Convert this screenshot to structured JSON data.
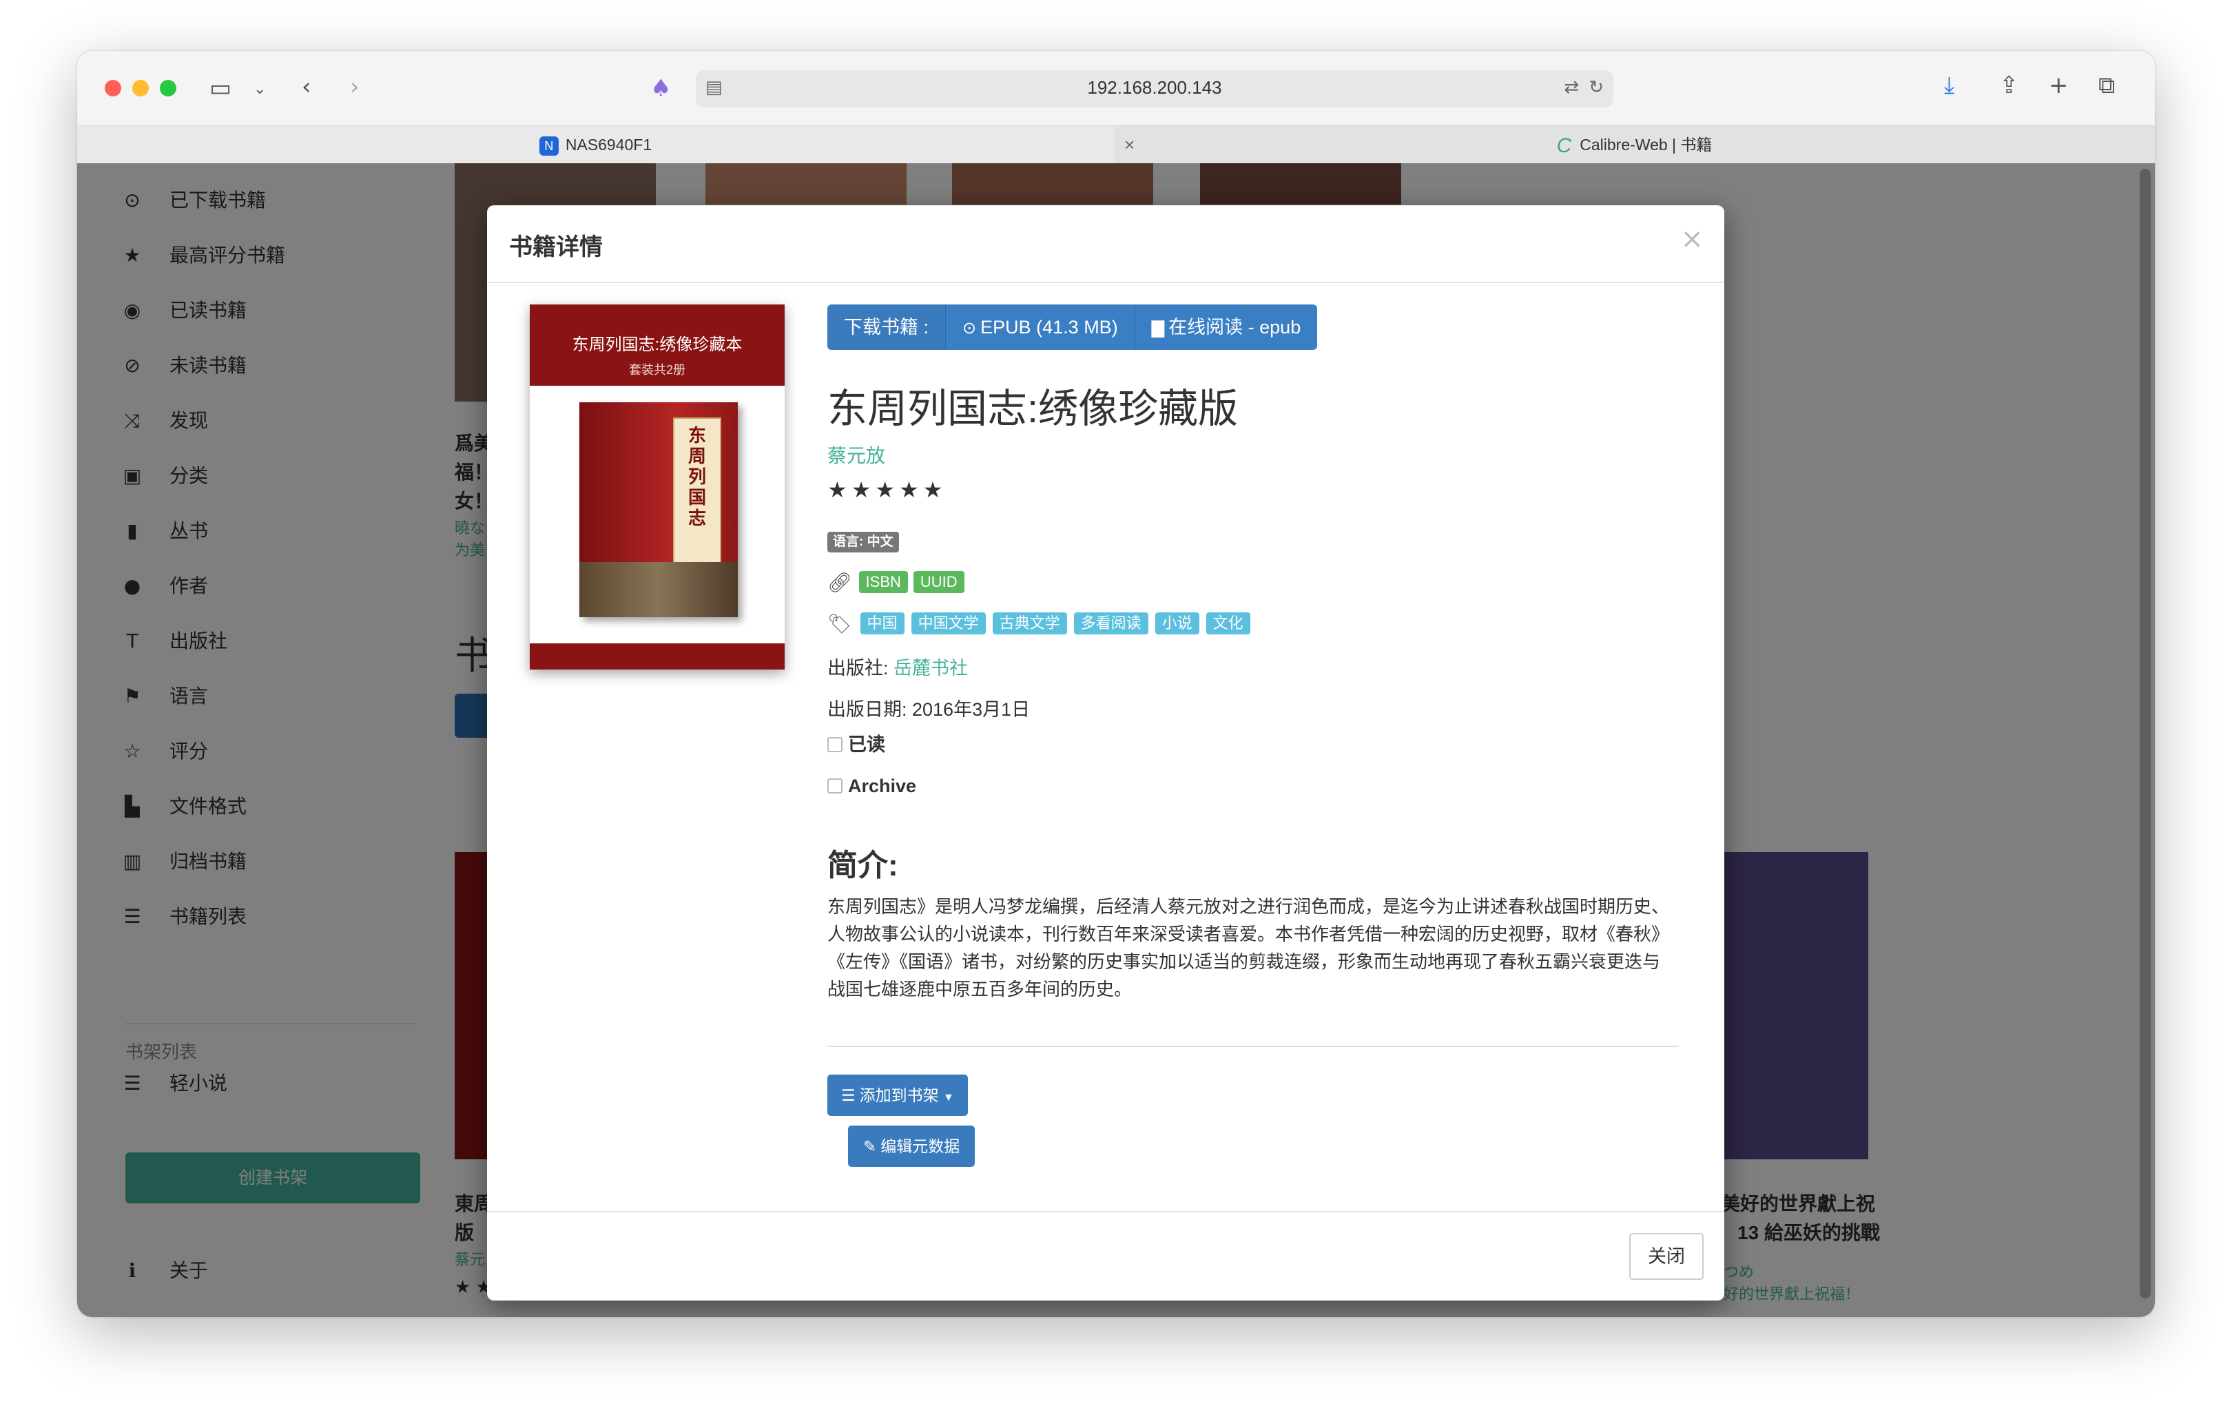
{
  "browser": {
    "url": "192.168.200.143",
    "tabs": [
      {
        "label": "NAS6940F1",
        "favicon": "N"
      },
      {
        "label": "Calibre-Web | 书籍",
        "favicon": "C"
      }
    ],
    "icons": [
      "sidebar-toggle-icon",
      "chevron-down-icon",
      "back-icon",
      "forward-icon",
      "extension-icon",
      "site-settings-icon",
      "translate-icon",
      "reload-icon",
      "downloads-icon",
      "share-icon",
      "new-tab-icon",
      "tab-overview-icon"
    ]
  },
  "sidebar": {
    "items": [
      {
        "label": "已下载书籍",
        "icon": "download-icon"
      },
      {
        "label": "最高评分书籍",
        "icon": "star-icon"
      },
      {
        "label": "已读书籍",
        "icon": "eye-icon"
      },
      {
        "label": "未读书籍",
        "icon": "eye-slash-icon"
      },
      {
        "label": "发现",
        "icon": "random-icon"
      },
      {
        "label": "分类",
        "icon": "inbox-icon"
      },
      {
        "label": "丛书",
        "icon": "bookmark-icon"
      },
      {
        "label": "作者",
        "icon": "user-icon"
      },
      {
        "label": "出版社",
        "icon": "text-size-icon"
      },
      {
        "label": "语言",
        "icon": "flag-icon"
      },
      {
        "label": "评分",
        "icon": "star-empty-icon"
      },
      {
        "label": "文件格式",
        "icon": "file-icon"
      },
      {
        "label": "归档书籍",
        "icon": "trash-icon"
      },
      {
        "label": "书籍列表",
        "icon": "list-icon"
      }
    ],
    "shelves_header": "书架列表",
    "shelves": [
      {
        "label": "轻小说",
        "icon": "list-icon"
      }
    ],
    "create_shelf": "创建书架",
    "about": "关于"
  },
  "background": {
    "texts": [
      "爲美",
      "福！",
      "女！",
      "東周",
      "版",
      "美好的世界獻上祝",
      "13 給巫妖的挑戰"
    ],
    "links": [
      "曉な",
      "为美",
      "蔡元",
      "つめ",
      "好的世界獻上祝福！"
    ],
    "heading_fragment": "书",
    "stars": "★ ★"
  },
  "modal": {
    "title": "书籍详情",
    "close_x": "×",
    "cover": {
      "title": "东周列国志:绣像珍藏本",
      "subtitle": "套装共2册",
      "spine": "东周列国志"
    },
    "download_label": "下载书籍 :",
    "download_epub": "EPUB (41.3 MB)",
    "read_online": "在线阅读 - epub",
    "book_title": "东周列国志:绣像珍藏版",
    "author": "蔡元放",
    "rating_stars": "★★★★★",
    "language": "语言: 中文",
    "identifiers": [
      "ISBN",
      "UUID"
    ],
    "tags": [
      "中国",
      "中国文学",
      "古典文学",
      "多看阅读",
      "小说",
      "文化"
    ],
    "publisher_label": "出版社:",
    "publisher": "岳麓书社",
    "pubdate": "出版日期: 2016年3月1日",
    "read_label": "已读",
    "archive_label": "Archive",
    "description_heading": "简介:",
    "description": "东周列国志》是明人冯梦龙编撰，后经清人蔡元放对之进行润色而成，是迄今为止讲述春秋战国时期历史、人物故事公认的小说读本，刊行数百年来深受读者喜爱。本书作者凭借一种宏阔的历史视野，取材《春秋》《左传》《国语》诸书，对纷繁的历史事实加以适当的剪裁连缀，形象而生动地再现了春秋五霸兴衰更迭与战国七雄逐鹿中原五百多年间的历史。",
    "add_to_shelf": "添加到书架",
    "edit_metadata": "编辑元数据",
    "close_button": "关闭"
  },
  "colors": {
    "accent": "#45b29d",
    "primary": "#3a7bbd",
    "label_green": "#5cb85c",
    "label_blue": "#5bc0de"
  }
}
